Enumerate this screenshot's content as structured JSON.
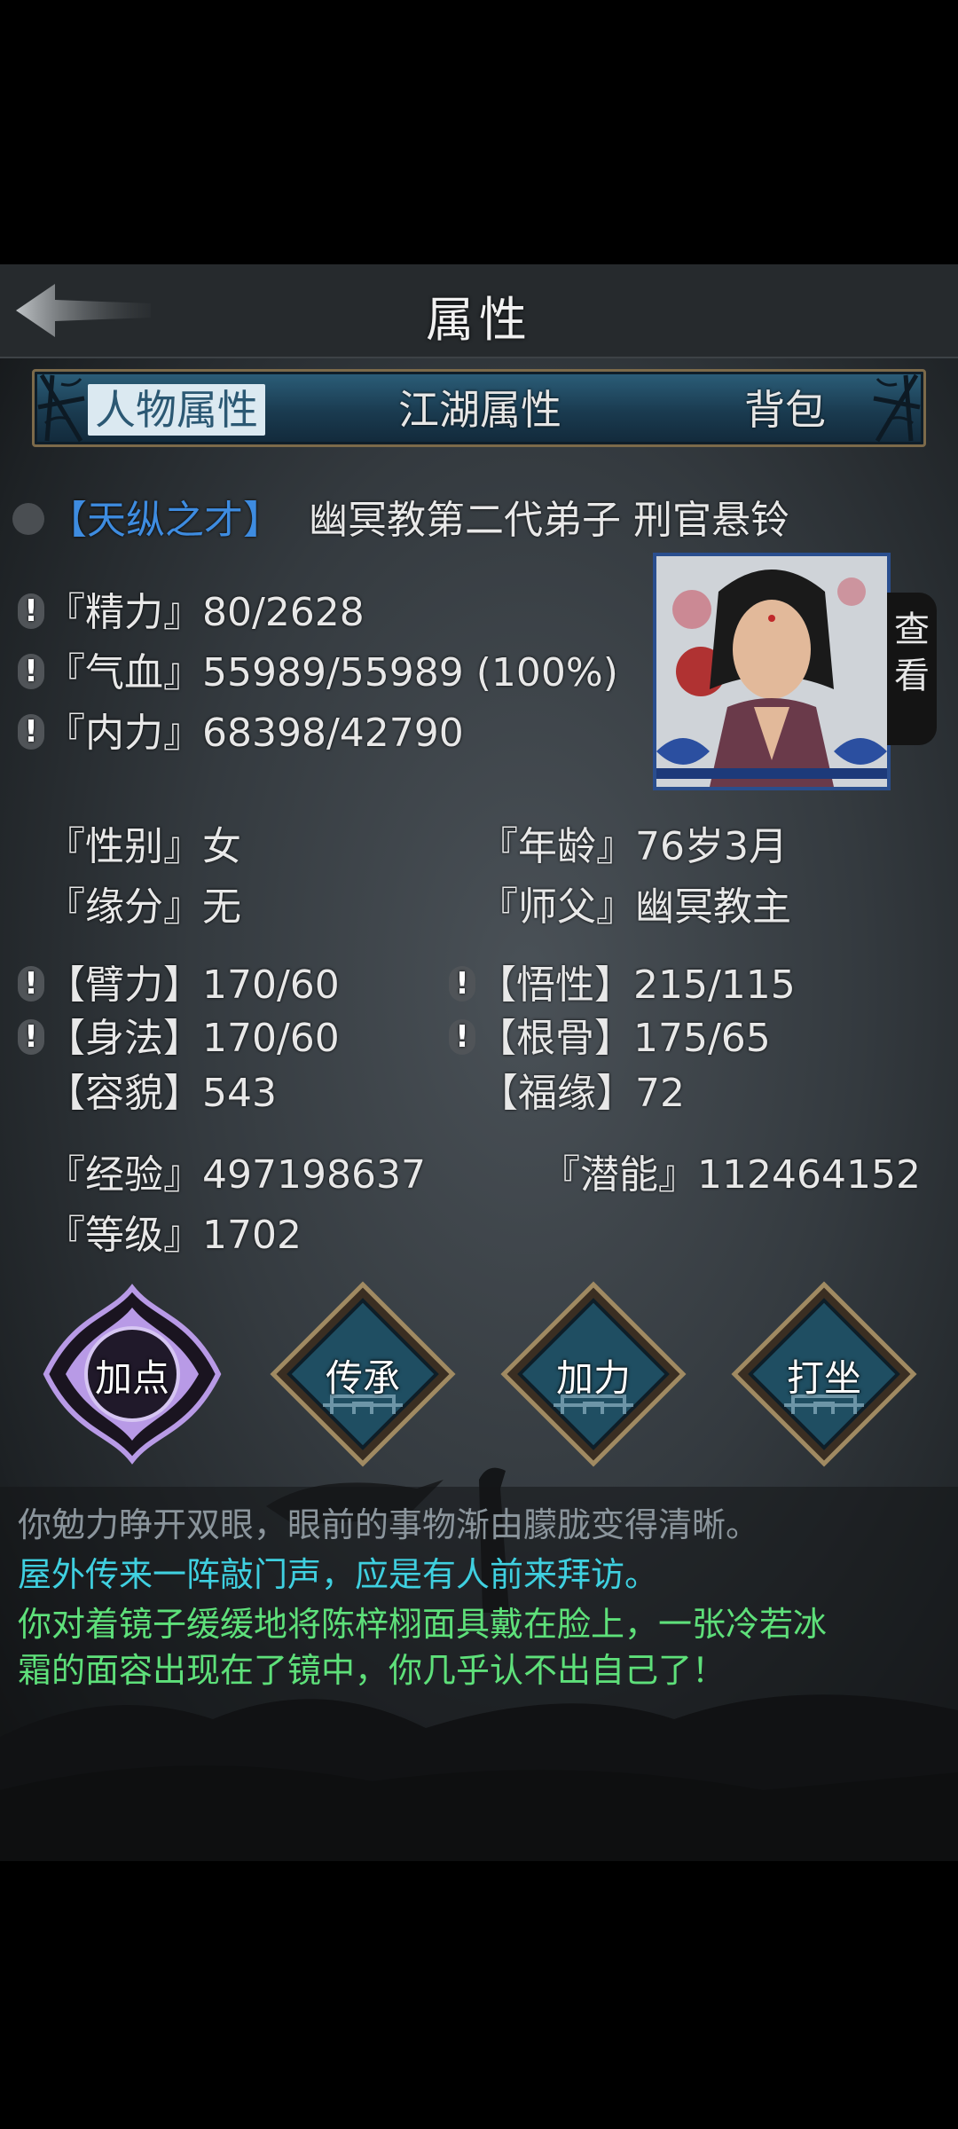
{
  "header": {
    "title": "属性"
  },
  "tabs": [
    {
      "label": "人物属性",
      "active": true
    },
    {
      "label": "江湖属性",
      "active": false
    },
    {
      "label": "背包",
      "active": false
    }
  ],
  "character": {
    "talent": "【天纵之才】",
    "title": "幽冥教第二代弟子 刑官悬铃",
    "view_button": "查看"
  },
  "vitals": [
    {
      "label": "『精力』",
      "value": "80/2628"
    },
    {
      "label": "『气血』",
      "value": "55989/55989 (100%)"
    },
    {
      "label": "『内力』",
      "value": "68398/42790"
    }
  ],
  "info": {
    "gender_label": "『性别』",
    "gender": "女",
    "age_label": "『年龄』",
    "age": "76岁3月",
    "fate_label": "『缘分』",
    "fate": "无",
    "master_label": "『师父』",
    "master": "幽冥教主"
  },
  "attributes": {
    "strength_label": "【臂力】",
    "strength": "170/60",
    "insight_label": "【悟性】",
    "insight": "215/115",
    "agility_label": "【身法】",
    "agility": "170/60",
    "constitution_label": "【根骨】",
    "constitution": "175/65",
    "appearance_label": "【容貌】",
    "appearance": "543",
    "luck_label": "【福缘】",
    "luck": "72"
  },
  "progress": {
    "exp_label": "『经验』",
    "exp": "497198637",
    "potential_label": "『潜能』",
    "potential": "112464152",
    "level_label": "『等级』",
    "level": "1702"
  },
  "actions": [
    {
      "label": "加点"
    },
    {
      "label": "传承"
    },
    {
      "label": "加力"
    },
    {
      "label": "打坐"
    }
  ],
  "log": [
    {
      "text": "你勉力睁开双眼，眼前的事物渐由朦胧变得清晰。"
    },
    {
      "text": "屋外传来一阵敲门声，应是有人前来拜访。"
    },
    {
      "text": "你对着镜子缓缓地将陈梓栩面具戴在脸上，一张冷若冰"
    },
    {
      "text": "霜的面容出现在了镜中，你几乎认不出自己了！"
    }
  ],
  "colors": {
    "talent": "#3e8ce0",
    "log_normal": "#8b959c",
    "log_cyan": "#3fd0e0",
    "log_green": "#5ee07a",
    "tab_bg": "#1e4660",
    "active_action": "#b89ae6"
  },
  "icons": {
    "back": "back-arrow-icon",
    "warning": "exclamation-icon",
    "toggle": "talent-toggle-icon"
  }
}
